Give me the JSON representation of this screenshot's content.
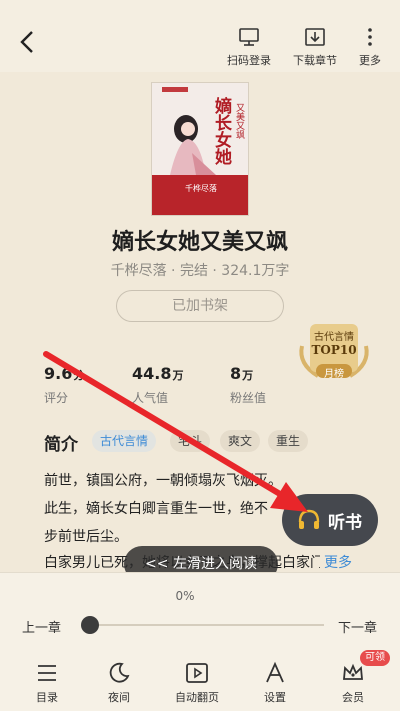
{
  "topbar": {
    "actions": [
      {
        "label": "扫码登录",
        "icon": "monitor-icon"
      },
      {
        "label": "下载章节",
        "icon": "download-icon"
      },
      {
        "label": "更多",
        "icon": "more-vertical-icon"
      }
    ]
  },
  "book": {
    "title": "嫡长女她又美又飒",
    "meta": "千桦尽落 · 完结 · 324.1万字",
    "shelf_label": "已加书架",
    "cover": {
      "title_art": "嫡长女她",
      "subtitle_art": "又美又飒",
      "author_art": "千桦尽落"
    },
    "badge": {
      "line1": "古代言情",
      "line2": "TOP10",
      "line3": "月榜"
    }
  },
  "stats": [
    {
      "num": "9.6",
      "unit": "分",
      "label": "评分"
    },
    {
      "num": "44.8",
      "unit": "万",
      "label": "人气值"
    },
    {
      "num": "8",
      "unit": "万",
      "label": "粉丝值"
    }
  ],
  "intro": {
    "heading": "简介",
    "tags": [
      "古代言情",
      "宅斗",
      "爽文",
      "重生"
    ],
    "lines": [
      "前世，镇国公府，一朝倾塌灰飞烟灭。",
      "此生，嫡长女白卿言重生一世，绝不",
      "步前世后尘。",
      "白家男儿已死，她将以女子之身，撑起白家门楣，锋之…"
    ],
    "more": "更多"
  },
  "listen_label": "听书",
  "swipe_hint": "<< 左滑进入阅读",
  "progress": {
    "percent_label": "0%",
    "value": 0
  },
  "chapter": {
    "prev": "上一章",
    "next": "下一章"
  },
  "bottom_nav": [
    {
      "label": "目录",
      "icon": "list-icon"
    },
    {
      "label": "夜间",
      "icon": "moon-icon"
    },
    {
      "label": "自动翻页",
      "icon": "autoplay-icon"
    },
    {
      "label": "设置",
      "icon": "font-settings-icon"
    },
    {
      "label": "会员",
      "icon": "crown-icon"
    }
  ],
  "vip_badge": "可领",
  "colors": {
    "background": "#f1eadb",
    "accent": "#3d8bd6",
    "arrow": "#e8262a",
    "listen": "#45484e"
  }
}
